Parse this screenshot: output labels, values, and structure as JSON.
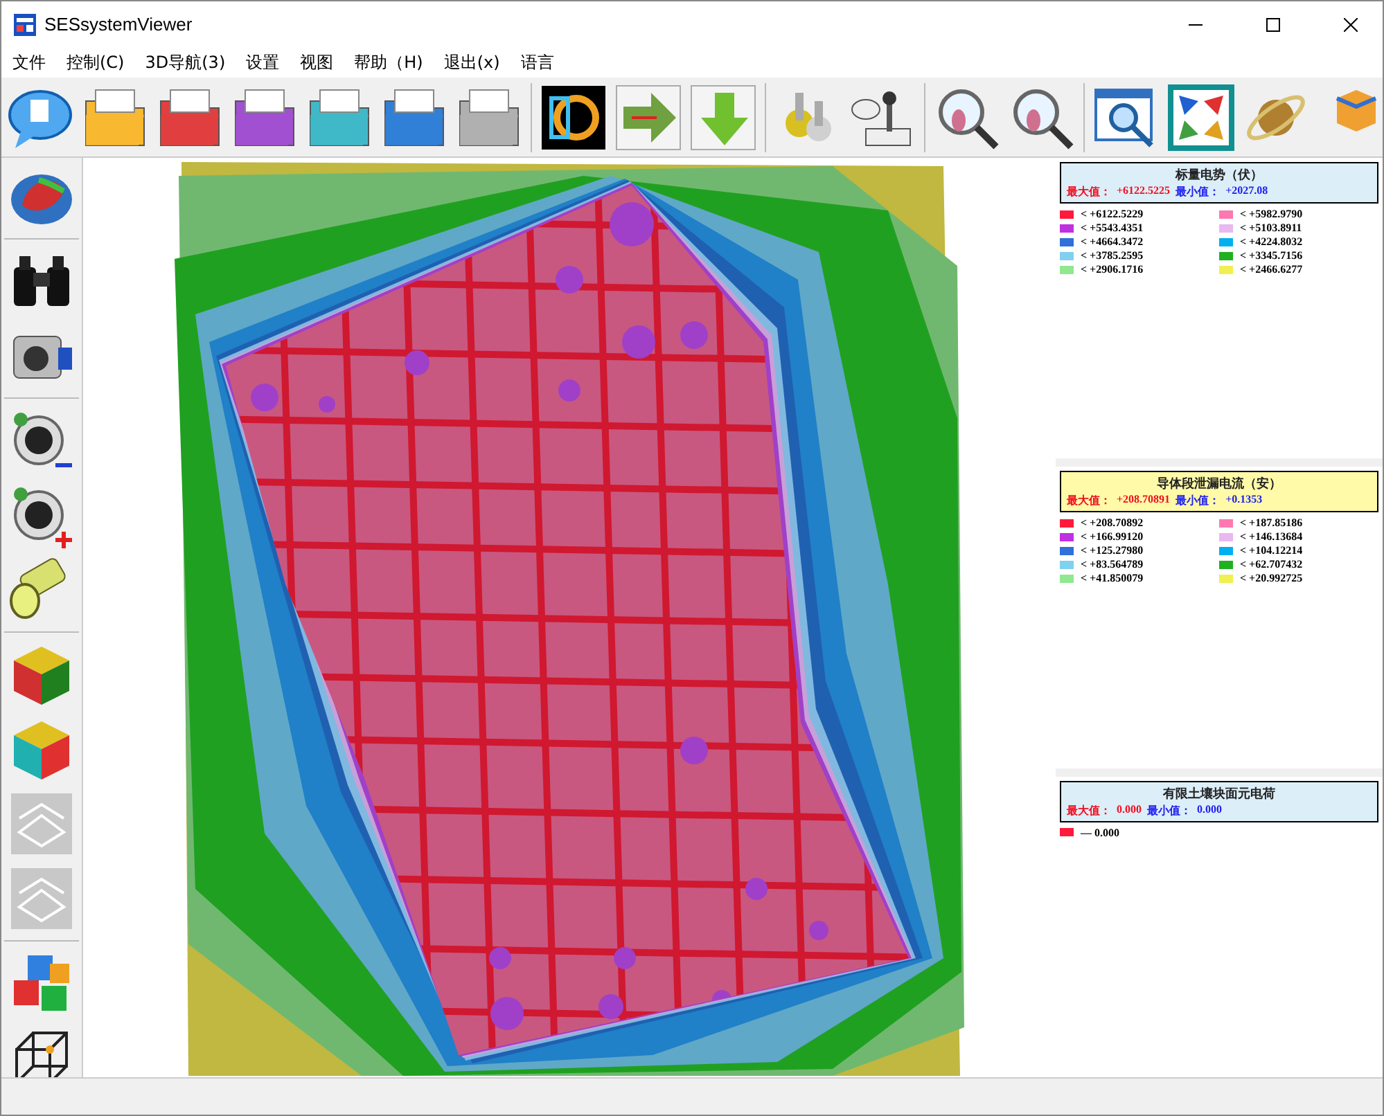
{
  "window": {
    "title": "SESsystemViewer"
  },
  "menu": [
    "文件",
    "控制(C)",
    "3D导航(3)",
    "设置",
    "视图",
    "帮助（H)",
    "退出(x)",
    "语言"
  ],
  "legends": [
    {
      "title": "标量电势（伏）",
      "color": "#dceef8",
      "max_label": "最大值：",
      "max_value": "+6122.5225",
      "min_label": "最小值：",
      "min_value": "+2027.08",
      "items": [
        {
          "color": "#ff1a3c",
          "text": "< +6122.5229"
        },
        {
          "color": "#ff78b0",
          "text": "< +5982.9790"
        },
        {
          "color": "#c030e0",
          "text": "< +5543.4351"
        },
        {
          "color": "#e8b8f0",
          "text": "< +5103.8911"
        },
        {
          "color": "#3070d8",
          "text": "< +4664.3472"
        },
        {
          "color": "#00b0f0",
          "text": "< +4224.8032"
        },
        {
          "color": "#80d0f0",
          "text": "< +3785.2595"
        },
        {
          "color": "#20b020",
          "text": "< +3345.7156"
        },
        {
          "color": "#90e890",
          "text": "< +2906.1716"
        },
        {
          "color": "#f0f050",
          "text": "< +2466.6277"
        }
      ]
    },
    {
      "title": "导体段泄漏电流（安）",
      "color": "#fffaa8",
      "max_label": "最大值：",
      "max_value": "+208.70891",
      "min_label": "最小值：",
      "min_value": "+0.1353",
      "items": [
        {
          "color": "#ff1a3c",
          "text": "< +208.70892"
        },
        {
          "color": "#ff78b0",
          "text": "< +187.85186"
        },
        {
          "color": "#c030e0",
          "text": "< +166.99120"
        },
        {
          "color": "#e8b8f0",
          "text": "< +146.13684"
        },
        {
          "color": "#3070d8",
          "text": "< +125.27980"
        },
        {
          "color": "#00b0f0",
          "text": "< +104.12214"
        },
        {
          "color": "#80d0f0",
          "text": "< +83.564789"
        },
        {
          "color": "#20b020",
          "text": "< +62.707432"
        },
        {
          "color": "#90e890",
          "text": "< +41.850079"
        },
        {
          "color": "#f0f050",
          "text": "< +20.992725"
        }
      ]
    },
    {
      "title": "有限土壤块面元电荷",
      "color": "#dceef8",
      "max_label": "最大值：",
      "max_value": "0.000",
      "min_label": "最小值：",
      "min_value": "0.000",
      "items": [
        {
          "color": "#ff1a3c",
          "text": "—  0.000"
        }
      ]
    }
  ]
}
